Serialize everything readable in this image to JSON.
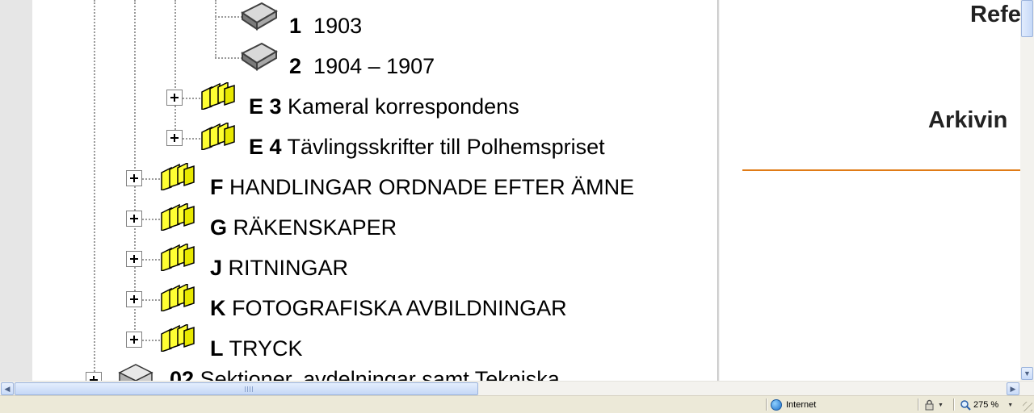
{
  "tree": {
    "nodes": [
      {
        "code": "1",
        "title": "1903",
        "icon": "book-icon"
      },
      {
        "code": "2",
        "title": "1904 – 1907",
        "icon": "book-icon"
      },
      {
        "code": "E 3",
        "title": "Kameral korrespondens",
        "icon": "folder-stack-icon"
      },
      {
        "code": "E 4",
        "title": "Tävlingsskrifter till Polhemspriset",
        "icon": "folder-stack-icon"
      },
      {
        "code": "F",
        "title": "HANDLINGAR ORDNADE EFTER ÄMNE",
        "icon": "folder-stack-icon"
      },
      {
        "code": "G",
        "title": "RÄKENSKAPER",
        "icon": "folder-stack-icon"
      },
      {
        "code": "J",
        "title": "RITNINGAR",
        "icon": "folder-stack-icon"
      },
      {
        "code": "K",
        "title": "FOTOGRAFISKA AVBILDNINGAR",
        "icon": "folder-stack-icon"
      },
      {
        "code": "L",
        "title": "TRYCK",
        "icon": "folder-stack-icon"
      },
      {
        "code": "02",
        "title": "Sektioner, avdelningar samt Tekniska",
        "icon": "archive-box-icon"
      }
    ]
  },
  "right_pane": {
    "heading_top": "Refe",
    "heading_mid": "Arkivin",
    "accent_color": "#e07b16"
  },
  "status_bar": {
    "zone": "Internet",
    "zoom": "275 %"
  }
}
